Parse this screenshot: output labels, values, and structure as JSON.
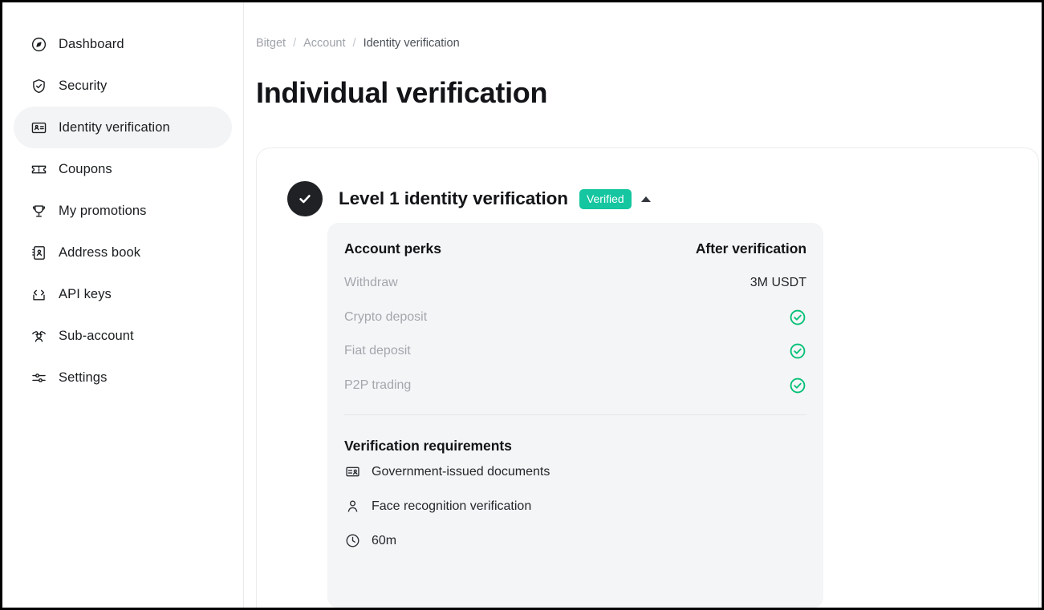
{
  "sidebar": {
    "items": [
      {
        "label": "Dashboard",
        "icon": "compass-icon",
        "active": false
      },
      {
        "label": "Security",
        "icon": "shield-check-icon",
        "active": false
      },
      {
        "label": "Identity verification",
        "icon": "id-card-icon",
        "active": true
      },
      {
        "label": "Coupons",
        "icon": "ticket-icon",
        "active": false
      },
      {
        "label": "My promotions",
        "icon": "trophy-icon",
        "active": false
      },
      {
        "label": "Address book",
        "icon": "address-book-icon",
        "active": false
      },
      {
        "label": "API keys",
        "icon": "code-icon",
        "active": false
      },
      {
        "label": "Sub-account",
        "icon": "users-icon",
        "active": false
      },
      {
        "label": "Settings",
        "icon": "sliders-icon",
        "active": false
      }
    ]
  },
  "breadcrumb": {
    "items": [
      "Bitget",
      "Account",
      "Identity verification"
    ],
    "separator": "/"
  },
  "page": {
    "title": "Individual verification"
  },
  "level_card": {
    "status_icon": "check-circle-filled-icon",
    "title": "Level 1 identity verification",
    "badge": "Verified",
    "badge_color": "#15c6a0",
    "collapse_icon": "caret-up-icon",
    "perks": {
      "header_left": "Account perks",
      "header_right": "After verification",
      "rows": [
        {
          "label": "Withdraw",
          "value": "3M USDT",
          "value_type": "text"
        },
        {
          "label": "Crypto deposit",
          "value": "",
          "value_type": "check"
        },
        {
          "label": "Fiat deposit",
          "value": "",
          "value_type": "check"
        },
        {
          "label": "P2P trading",
          "value": "",
          "value_type": "check"
        }
      ],
      "check_color": "#00c076"
    },
    "requirements": {
      "title": "Verification requirements",
      "items": [
        {
          "label": "Government-issued documents",
          "icon": "document-id-icon"
        },
        {
          "label": "Face recognition verification",
          "icon": "person-icon"
        },
        {
          "label": "60m",
          "icon": "clock-icon"
        }
      ]
    }
  }
}
